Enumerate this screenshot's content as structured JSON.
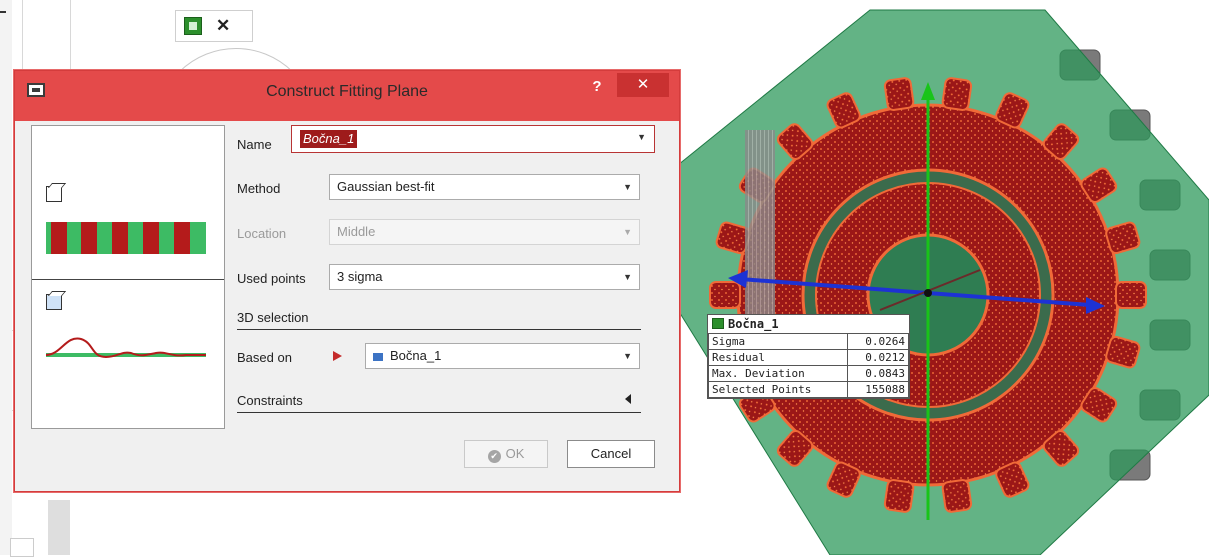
{
  "app": {
    "mini_toolbar": {
      "plane_icon": "plane-icon",
      "close_icon": "close-icon",
      "close_glyph": "✕"
    }
  },
  "dialog": {
    "title": "Construct Fitting Plane",
    "help_label": "?",
    "close_glyph": "✕",
    "name": {
      "label": "Name",
      "value": "Bočna_1"
    },
    "method": {
      "label": "Method",
      "value": "Gaussian best-fit"
    },
    "location": {
      "label": "Location",
      "value": "Middle",
      "enabled": false
    },
    "used_points": {
      "label": "Used points",
      "value": "3 sigma"
    },
    "selection_section": "3D selection",
    "based_on": {
      "label": "Based on",
      "value": "Bočna_1"
    },
    "constraints_section": "Constraints",
    "ok_label": "OK",
    "cancel_label": "Cancel",
    "colors": {
      "title_bar": "#e44a4a",
      "accent_red": "#b41b1b",
      "accent_green": "#3dbb64",
      "selection_blue": "#3c73c4"
    }
  },
  "info_panel": {
    "title": "Bočna_1",
    "rows": [
      {
        "label": "Sigma",
        "value": "0.0264"
      },
      {
        "label": "Residual",
        "value": "0.0212"
      },
      {
        "label": "Max. Deviation",
        "value": "0.0843"
      },
      {
        "label": "Selected Points",
        "value": "155088"
      }
    ]
  },
  "viewport": {
    "object": "gear-3d-model",
    "plane_color": "#2f9a5c",
    "points_color": "#a01515",
    "outline_color": "#f06a38"
  }
}
